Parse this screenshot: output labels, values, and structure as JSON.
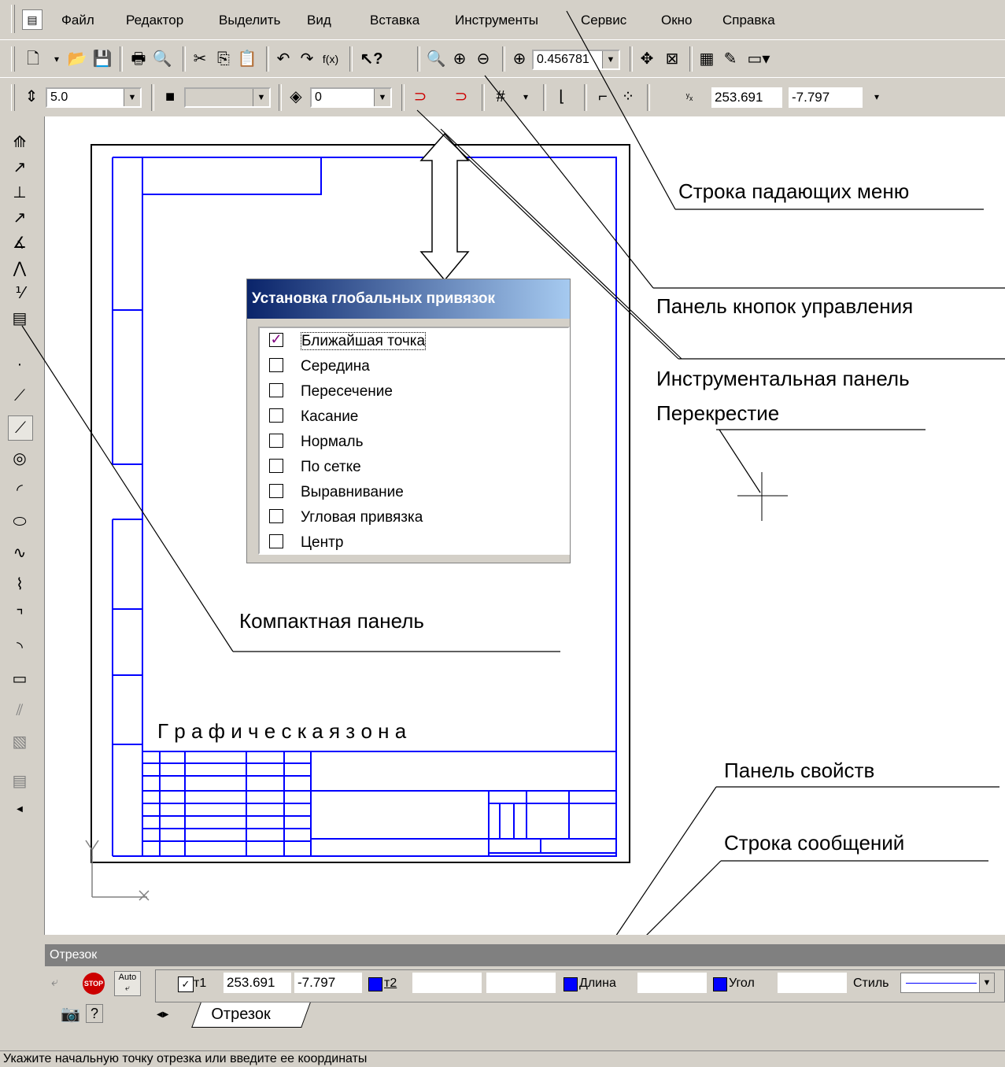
{
  "menu": {
    "items": [
      {
        "label": "Файл"
      },
      {
        "label": "Редактор"
      },
      {
        "label": "Выделить"
      },
      {
        "label": "Вид"
      },
      {
        "label": "Вставка"
      },
      {
        "label": "Инструменты"
      },
      {
        "label": "Сервис"
      },
      {
        "label": "Окно"
      },
      {
        "label": "Справка"
      }
    ]
  },
  "toolbar": {
    "zoom_value": "0.456781",
    "step_value": "5.0",
    "layer_value": "0",
    "coord_x": "253.691",
    "coord_y": "-7.797"
  },
  "dialog": {
    "title": "Установка глобальных привязок",
    "options": [
      {
        "label": "Ближайшая точка",
        "checked": true
      },
      {
        "label": "Середина",
        "checked": false
      },
      {
        "label": "Пересечение",
        "checked": false
      },
      {
        "label": "Касание",
        "checked": false
      },
      {
        "label": "Нормаль",
        "checked": false
      },
      {
        "label": "По сетке",
        "checked": false
      },
      {
        "label": "Выравнивание",
        "checked": false
      },
      {
        "label": "Угловая привязка",
        "checked": false
      },
      {
        "label": "Центр",
        "checked": false
      }
    ]
  },
  "callouts": {
    "menu_row": "Строка падающих меню",
    "control_panel": "Панель кнопок управления",
    "tool_panel": "Инструментальная панель",
    "crosshair": "Перекрестие",
    "compact_panel": "Компактная панель",
    "graphics_zone": "Г р а ф и ч е с к а я з о н а",
    "props_panel": "Панель свойств",
    "message_row": "Строка сообщений"
  },
  "props": {
    "title": "Отрезок",
    "t1_label": "т1",
    "t1_x": "253.691",
    "t1_y": "-7.797",
    "t2_label": "т2",
    "length_label": "Длина",
    "angle_label": "Угол",
    "style_label": "Стиль",
    "tab_label": "Отрезок",
    "auto_label": "Auto"
  },
  "status": {
    "message": "Укажите начальную точку отрезка или введите ее координаты"
  },
  "colors": {
    "frame_blue": "#0000ff",
    "title_start": "#0a246a",
    "title_end": "#a6caf0",
    "chrome": "#d4d0c8"
  }
}
